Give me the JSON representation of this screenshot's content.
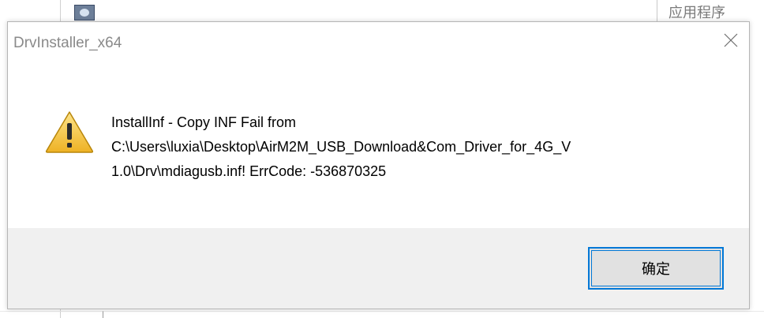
{
  "background": {
    "column_header": "应用程序"
  },
  "dialog": {
    "title": "DrvInstaller_x64",
    "icon": "warning-icon",
    "message_lines": [
      "InstallInf - Copy INF Fail from",
      "C:\\Users\\luxia\\Desktop\\AirM2M_USB_Download&Com_Driver_for_4G_V",
      "1.0\\Drv\\mdiagusb.inf! ErrCode: -536870325"
    ],
    "ok_label": "确定"
  },
  "colors": {
    "accent": "#0078d7",
    "footer_bg": "#f0f0f0",
    "warning_yellow": "#f4c542"
  }
}
